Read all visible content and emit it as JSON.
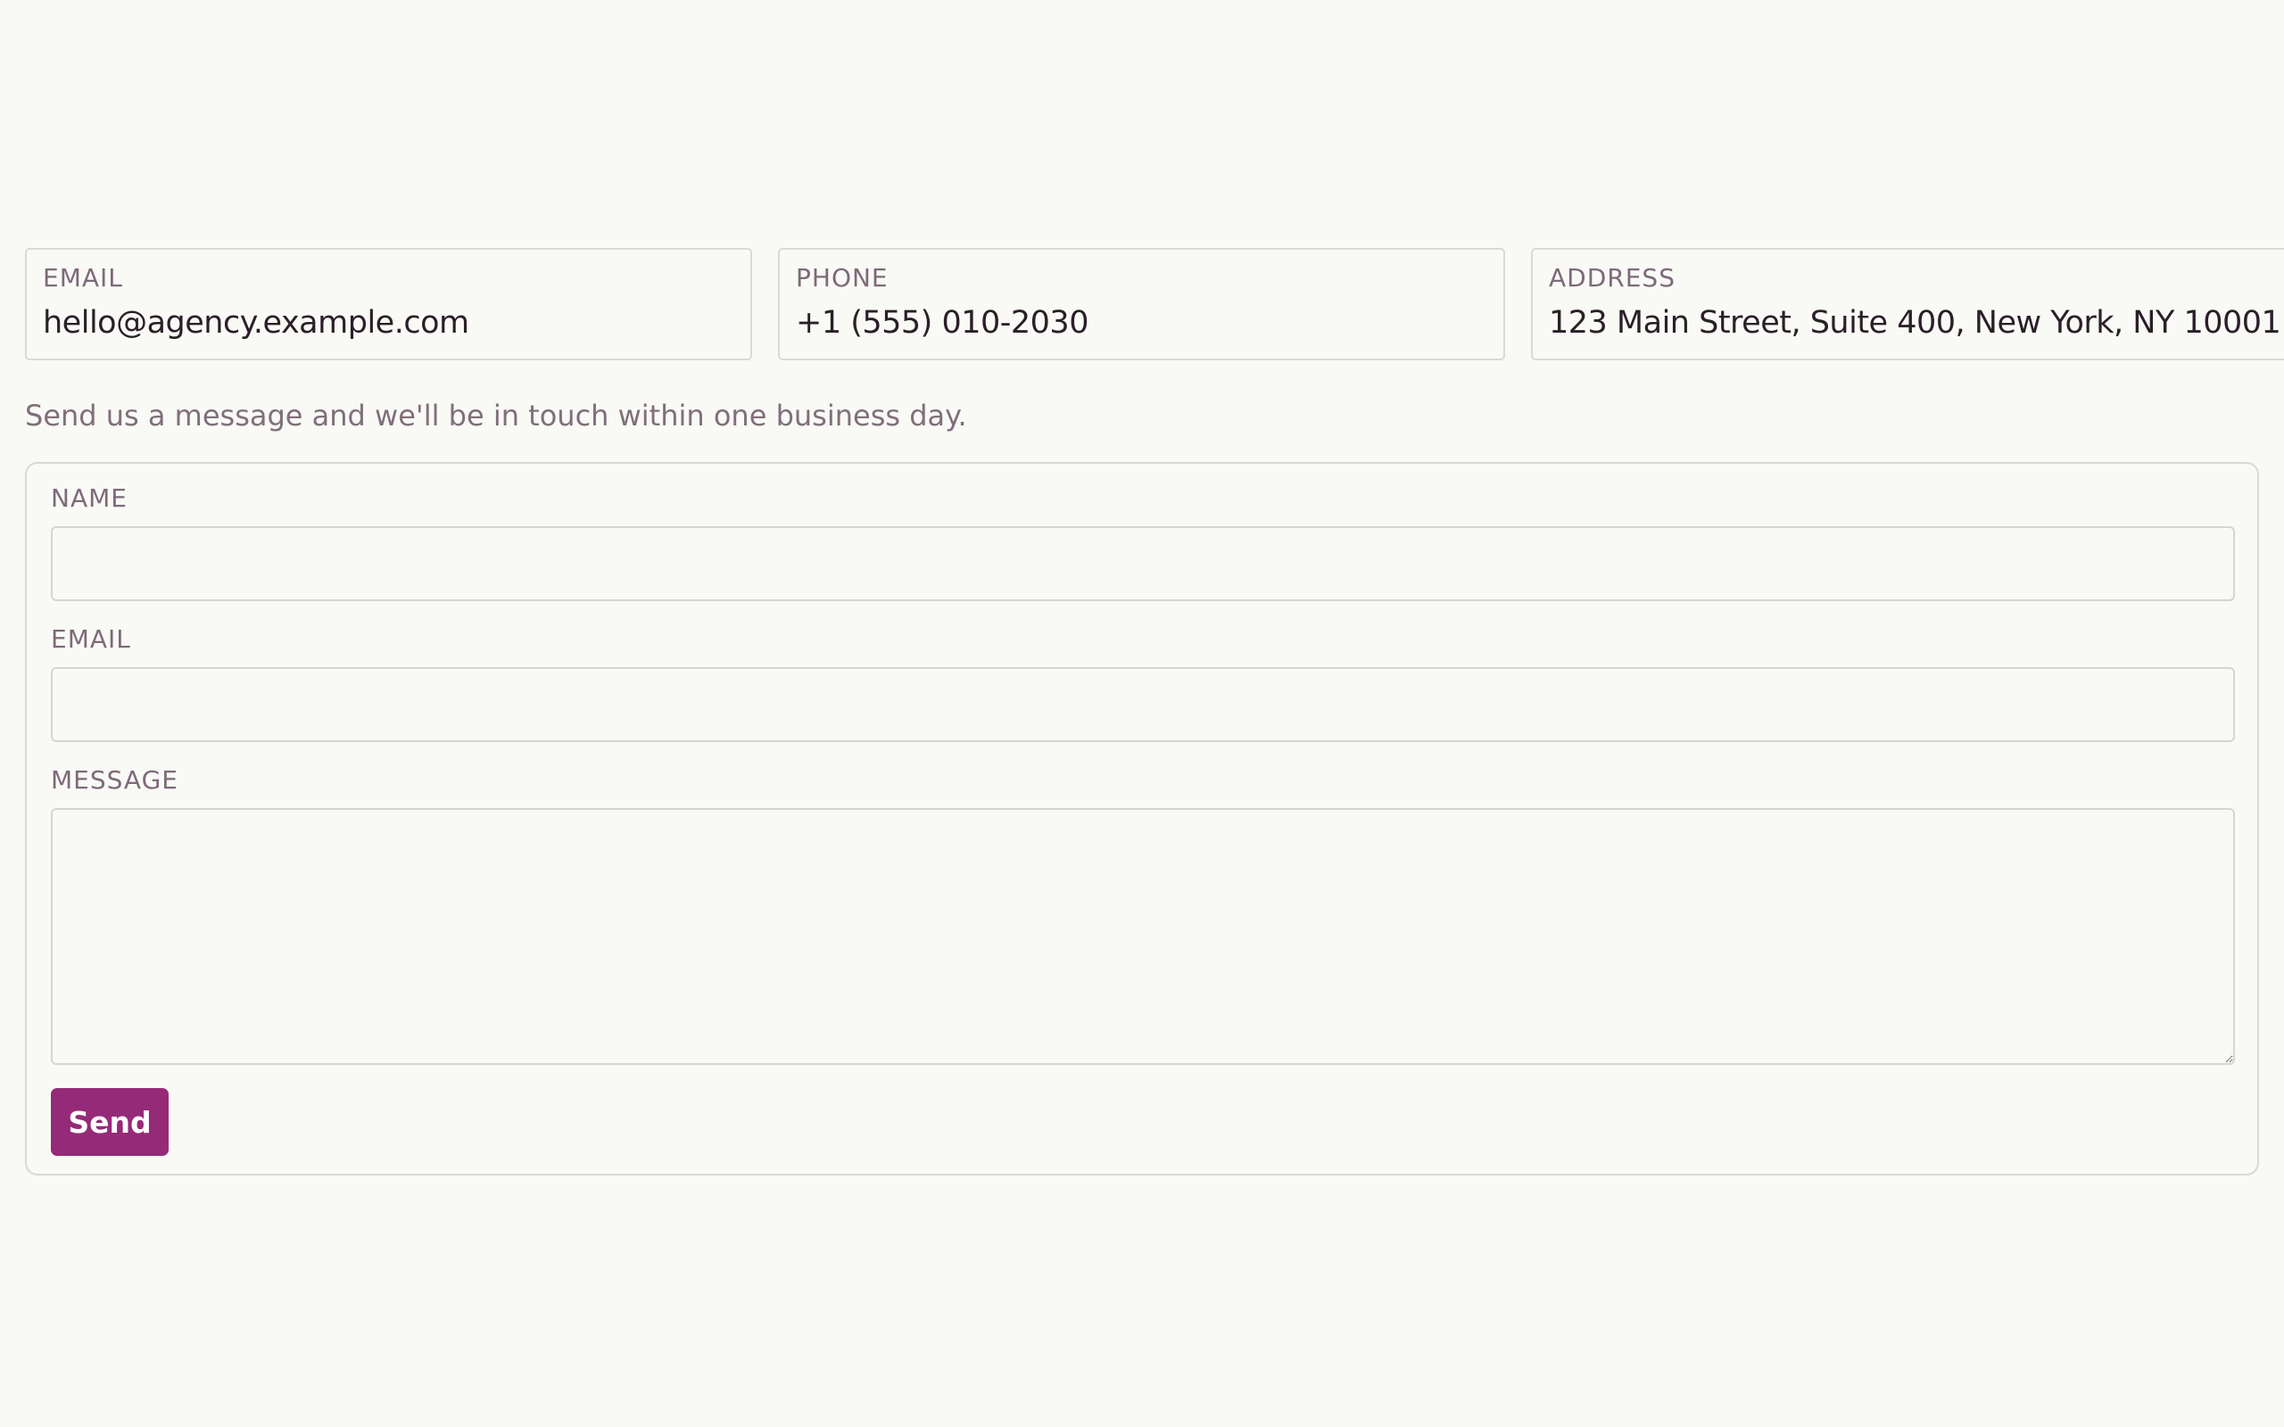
{
  "contact_info": {
    "email": {
      "label": "EMAIL",
      "value": "hello@agency.example.com"
    },
    "phone": {
      "label": "PHONE",
      "value": "+1 (555) 010-2030"
    },
    "address": {
      "label": "ADDRESS",
      "value": "123 Main Street, Suite 400, New York, NY 10001"
    }
  },
  "intro_text": "Send us a message and we'll be in touch within one business day.",
  "form": {
    "name": {
      "label": "NAME",
      "value": ""
    },
    "email": {
      "label": "EMAIL",
      "value": ""
    },
    "message": {
      "label": "MESSAGE",
      "value": ""
    },
    "submit_label": "Send"
  },
  "colors": {
    "accent": "#952a78",
    "background": "#f9f9f5",
    "label": "#7d6a7a",
    "border": "#dcd8d5"
  }
}
